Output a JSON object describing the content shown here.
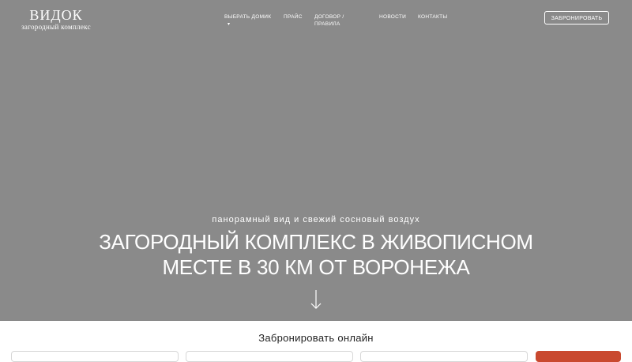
{
  "logo": {
    "title": "ВИДОК",
    "subtitle": "загородный комплекс"
  },
  "nav": {
    "items": [
      {
        "label": "ВЫБРАТЬ ДОМИК",
        "has_dropdown": true
      },
      {
        "label": "ПРАЙС"
      },
      {
        "label": "ДОГОВОР / ПРАВИЛА"
      },
      {
        "label": "НОВОСТИ"
      },
      {
        "label": "КОНТАКТЫ"
      }
    ],
    "caret": "▾"
  },
  "header": {
    "book_button": "ЗАБРОНИРОВАТЬ"
  },
  "hero": {
    "tagline": "панорамный вид и свежий сосновый воздух",
    "headline_line1": "ЗАГОРОДНЫЙ КОМПЛЕКС В ЖИВОПИСНОМ",
    "headline_line2": "МЕСТЕ В 30 КМ ОТ ВОРОНЕЖА",
    "arrow_icon": "arrow-down-icon"
  },
  "booking": {
    "title": "Забронировать онлайн"
  },
  "colors": {
    "hero_bg": "#8a8a8a",
    "accent": "#c9492f",
    "text": "#ffffff"
  }
}
